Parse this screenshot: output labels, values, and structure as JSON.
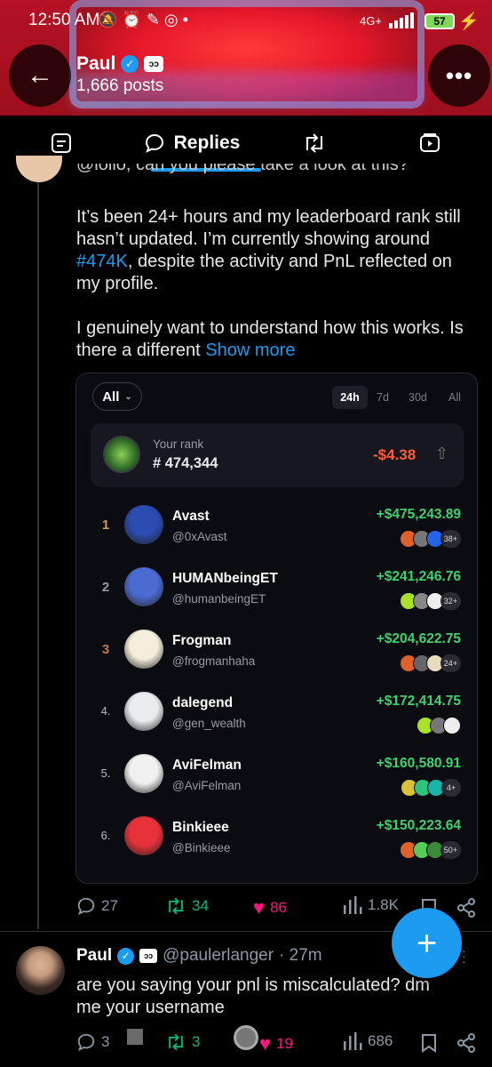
{
  "status": {
    "time": "12:50 AM",
    "battery": "57",
    "network": "4G+"
  },
  "header": {
    "name": "Paul",
    "posts": "1,666 posts"
  },
  "tabs": {
    "replies": "Replies"
  },
  "post": {
    "line1": "@lollo, can you please take a look at this?",
    "p1": "It’s been 24+ hours and my leaderboard rank still hasn’t updated. I’m currently showing around ",
    "p1_tag": "#474K",
    "p1_end": ", despite the activity and PnL reflected on my profile.",
    "p2": "I genuinely want to understand how this works. Is there a different ",
    "show_more": "Show more"
  },
  "card": {
    "filter": "All",
    "periods": [
      "24h",
      "7d",
      "30d",
      "All"
    ],
    "your_rank_label": "Your rank",
    "your_rank": "# 474,344",
    "your_pnl": "-$4.38",
    "rows": [
      {
        "rank": "1",
        "name": "Avast",
        "handle": "@0xAvast",
        "pnl": "+$475,243.89",
        "more": "38+",
        "color": "#2b4cb0"
      },
      {
        "rank": "2",
        "name": "HUMANbeingET",
        "handle": "@humanbeingET",
        "pnl": "+$241,246.76",
        "more": "32+",
        "color": "#4a6bd0"
      },
      {
        "rank": "3",
        "name": "Frogman",
        "handle": "@frogmanhaha",
        "pnl": "+$204,622.75",
        "more": "24+",
        "color": "#f3efdc"
      },
      {
        "rank": "4.",
        "name": "dalegend",
        "handle": "@gen_wealth",
        "pnl": "+$172,414.75",
        "more": "",
        "color": "#e9ecef"
      },
      {
        "rank": "5.",
        "name": "AviFelman",
        "handle": "@AviFelman",
        "pnl": "+$160,580.91",
        "more": "4+",
        "color": "#f0f0f0"
      },
      {
        "rank": "6.",
        "name": "Binkieee",
        "handle": "@Binkieee",
        "pnl": "+$150,223.64",
        "more": "50+",
        "color": "#e8323a"
      }
    ]
  },
  "actions1": {
    "replies": "27",
    "reposts": "34",
    "likes": "86",
    "views": "1.8K"
  },
  "reply": {
    "name": "Paul",
    "handle": "@paulerlanger",
    "time": "· 27m",
    "text": "are you saying your pnl is miscalculated? dm me your username"
  },
  "actions2": {
    "replies": "3",
    "reposts": "3",
    "likes": "19",
    "views": "686"
  },
  "colors": {
    "accent": "#1d9bf0",
    "like": "#f91880",
    "repost": "#00ba7c",
    "pnl_positive": "#3fd16f",
    "pnl_negative": "#ff5a3a"
  }
}
